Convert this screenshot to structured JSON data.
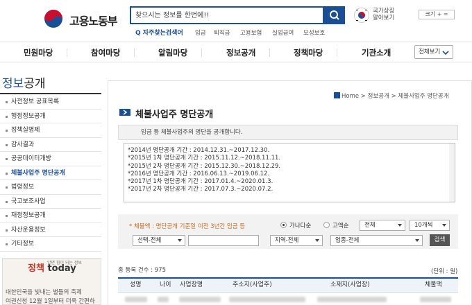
{
  "header": {
    "logo_text": "고용노동부",
    "search_placeholder": "찾으시는 정보를 한번에!!",
    "gov_symbol": [
      "국가상징",
      "알아보기"
    ],
    "size_ctrl": "크기 + =",
    "freq_search": "Q 자주찾는검색어",
    "quick_links": [
      "임금",
      "퇴직금",
      "고용보험",
      "실업급여",
      "모성보호"
    ]
  },
  "nav": {
    "items": [
      "민원마당",
      "참여마당",
      "알림마당",
      "정보공개",
      "정책마당",
      "기관소개"
    ],
    "all_label": "전체보기"
  },
  "sidebar": {
    "title_hl": "정보",
    "title_rest": "공개",
    "items": [
      "사전정보 공표목록",
      "행정정보공개",
      "정책실명제",
      "감사결과",
      "공공데이터개방",
      "체불사업주 명단공개",
      "법령정보",
      "국고보조사업",
      "재정정보공개",
      "자산운용정보",
      "기타정보"
    ],
    "active_index": 5,
    "today_logo_a": "정",
    "today_logo_b": "책",
    "today_logo_c": "today",
    "today_sub": "알면 힘이 되는 정보",
    "today_text1": "대한민국을 빛내는 별들의 축제",
    "today_text2": "여권신청 12월 1일부터 더욱 간편하"
  },
  "main": {
    "breadcrumb": "Home > 정보공개 > 체불사업주 명단공개",
    "title": "체불사업주 명단공개",
    "intro": "임금 등 체불사업주의 명단을 공개합니다.",
    "periods": [
      "*2014년 명단공개 기간 : 2014.12.31.~2017.12.30.",
      "*2015년 1차 명단공개 기간 : 2015.11.12.~2018.11.11.",
      "*2015년 2차 명단공개 기간 : 2015.12.30.~2018.12.29.",
      "*2016년 명단공개 기간 : 2016.06.13.~2019.06.12.",
      "*2017년 1차 명단공개 기간 : 2017.01.4.~2020.01.3.",
      "*2017년 2차 명단공개 기간 : 2017.07.3.~2020.07.2."
    ],
    "filter_note": "* 체불액 : 명단공개 기준일 이전 3년간 임금 등",
    "sort_options": [
      "가나다순",
      "고액순"
    ],
    "sort_selected": 0,
    "select_all": "전체",
    "page_size": "10개씩",
    "select_field": "선택-전체",
    "select_region": "지역-전체",
    "select_industry": "업종-전체",
    "search_button": "검색",
    "total": "총 등록 건수 : 975",
    "unit": "(단위 : 원)",
    "columns": [
      "성명",
      "나이",
      "사업장명",
      "주소지(사업주)",
      "소재지(사업장)",
      "체불액"
    ]
  }
}
